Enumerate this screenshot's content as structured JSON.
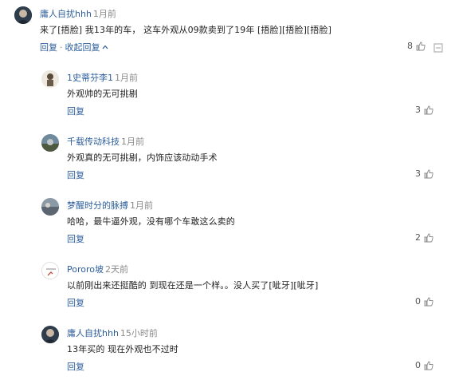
{
  "comments": [
    {
      "user": "庸人自扰hhh",
      "time": "1月前",
      "text": "来了[捂脸] 我13年的车， 这车外观从09款卖到了19年 [捂脸][捂脸][捂脸]",
      "reply_label": "回复",
      "collapse_label": "收起回复",
      "likes": "8"
    },
    {
      "user": "1史蒂芬李1",
      "time": "1月前",
      "text": "外观帅的无可挑剔",
      "reply_label": "回复",
      "likes": "3"
    },
    {
      "user": "千载传动科技",
      "time": "1月前",
      "text": "外观真的无可挑剔，内饰应该动动手术",
      "reply_label": "回复",
      "likes": "3"
    },
    {
      "user": "梦醒时分的脉搏",
      "time": "1月前",
      "text": "哈哈，最牛逼外观，没有哪个车敢这么卖的",
      "reply_label": "回复",
      "likes": "2"
    },
    {
      "user": "Pororo坡",
      "time": "2天前",
      "text": "以前刚出来还挺酷的 到现在还是一个样。。没人买了[呲牙][呲牙]",
      "reply_label": "回复",
      "likes": "0"
    },
    {
      "user": "庸人自扰hhh",
      "time": "15小时前",
      "text": "13年买的 现在外观也不过时",
      "reply_label": "回复",
      "likes": "0"
    }
  ]
}
